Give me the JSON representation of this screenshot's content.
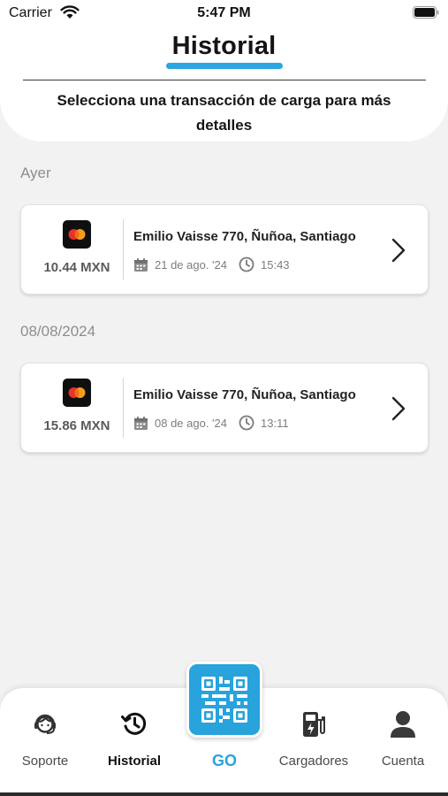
{
  "status_bar": {
    "carrier": "Carrier",
    "time": "5:47 PM"
  },
  "header": {
    "title": "Historial",
    "subtitle": "Selecciona una transacción de carga para más detalles"
  },
  "groups": [
    {
      "label": "Ayer",
      "transactions": [
        {
          "payment_icon": "mastercard-icon",
          "amount": "10.44 MXN",
          "address": "Emilio Vaisse 770, Ñuñoa, Santiago",
          "date": "21 de ago. '24",
          "time": "15:43"
        }
      ]
    },
    {
      "label": "08/08/2024",
      "transactions": [
        {
          "payment_icon": "mastercard-icon",
          "amount": "15.86 MXN",
          "address": "Emilio Vaisse 770, Ñuñoa, Santiago",
          "date": "08 de ago. '24",
          "time": "13:11"
        }
      ]
    }
  ],
  "tabbar": {
    "items": [
      {
        "label": "Soporte",
        "icon": "support-agent-icon",
        "active": false
      },
      {
        "label": "Historial",
        "icon": "history-icon",
        "active": true
      },
      {
        "label": "GO",
        "icon": "qr-code-icon",
        "active": false
      },
      {
        "label": "Cargadores",
        "icon": "ev-charger-icon",
        "active": false
      },
      {
        "label": "Cuenta",
        "icon": "user-icon",
        "active": false
      }
    ]
  },
  "colors": {
    "accent": "#28a3dc",
    "background": "#f2f2f2",
    "card": "#ffffff",
    "muted_text": "#8d8d8d"
  }
}
